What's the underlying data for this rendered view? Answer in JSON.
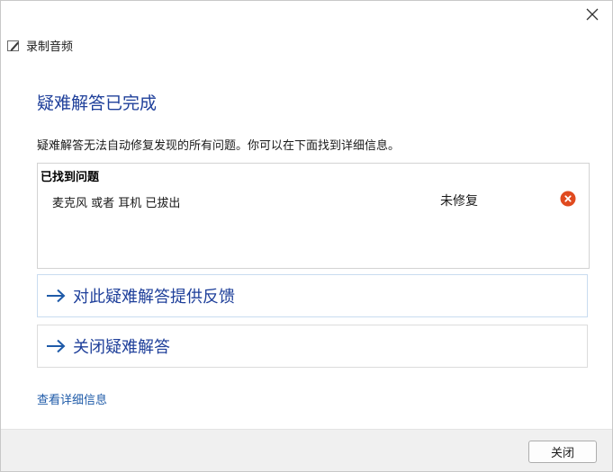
{
  "window": {
    "title": "录制音频",
    "app_icon": "pen-tool-icon",
    "close_icon": "close-icon"
  },
  "main": {
    "heading": "疑难解答已完成",
    "description": "疑难解答无法自动修复发现的所有问题。你可以在下面找到详细信息。",
    "found_problems": {
      "title": "已找到问题",
      "issues": [
        {
          "name": "麦克风 或者 耳机 已拔出",
          "status": "未修复",
          "status_icon": "error-x-circle-icon"
        }
      ]
    },
    "actions": [
      {
        "label": "对此疑难解答提供反馈",
        "icon": "arrow-right-icon"
      },
      {
        "label": "关闭疑难解答",
        "icon": "arrow-right-icon"
      }
    ],
    "details_link": "查看详细信息"
  },
  "footer": {
    "close_button": "关闭"
  },
  "colors": {
    "heading": "#1e3f9a",
    "link": "#1e5aa8",
    "error": "#e04a1f",
    "footer_bg": "#f0f0f0"
  }
}
